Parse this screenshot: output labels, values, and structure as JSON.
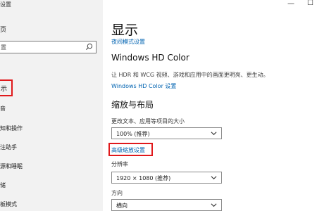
{
  "window": {
    "title": "设置",
    "minimize_glyph": "—",
    "maximize_glyph": "☐"
  },
  "sidebar": {
    "home_label": "页",
    "search_placeholder": "置",
    "section_label": "",
    "items": [
      {
        "label": "示",
        "selected": true
      },
      {
        "label": "音"
      },
      {
        "label": "知和操作"
      },
      {
        "label": "注助手"
      },
      {
        "label": "源和睡眠"
      },
      {
        "label": "储"
      },
      {
        "label": "板模式"
      }
    ]
  },
  "main": {
    "page_title": "显示",
    "night_light_link": "夜间模式设置",
    "hd_color": {
      "title": "Windows HD Color",
      "description": "让 HDR 和 WCG 视频、游戏和应用中的画面更明亮、更生动。",
      "link": "Windows HD Color 设置"
    },
    "scale_layout": {
      "title": "缩放与布局",
      "scale_label": "更改文本、应用等项目的大小",
      "scale_value": "100% (推荐)",
      "advanced_link": "高级缩放设置",
      "resolution_label": "分辨率",
      "resolution_value": "1920 × 1080 (推荐)",
      "orientation_label": "方向",
      "orientation_value": "横向"
    }
  },
  "colors": {
    "accent_link": "#0063b1",
    "highlight_box": "#e0191c",
    "sidebar_bg": "#f2f2f2"
  },
  "icons": [
    "search-icon",
    "chevron-down-icon",
    "minimize-icon",
    "maximize-icon"
  ]
}
